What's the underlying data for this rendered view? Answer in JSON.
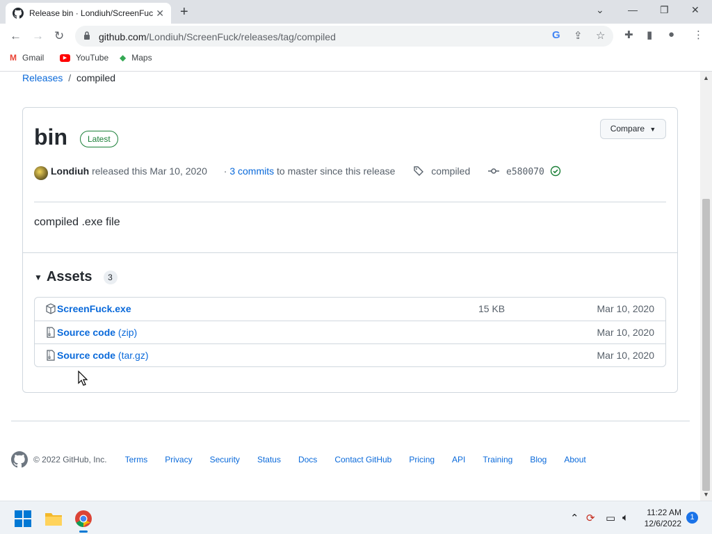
{
  "browser": {
    "tab_title": "Release bin · Londiuh/ScreenFuck",
    "url_host": "github.com",
    "url_path": "/Londiuh/ScreenFuck/releases/tag/compiled",
    "bookmarks": [
      {
        "label": "Gmail",
        "icon": "gmail-icon"
      },
      {
        "label": "YouTube",
        "icon": "youtube-icon"
      },
      {
        "label": "Maps",
        "icon": "maps-icon"
      }
    ]
  },
  "breadcrumb": {
    "parent": "Releases",
    "separator": "/",
    "current": "compiled"
  },
  "release": {
    "title": "bin",
    "badge": "Latest",
    "compare_label": "Compare",
    "author": "Londiuh",
    "released_text": "released this",
    "date": "Mar 10, 2020",
    "commits_prefix": "·",
    "commits_link": "3 commits",
    "commits_suffix": "to master since this release",
    "tag": "compiled",
    "commit_sha": "e580070",
    "description": "compiled .exe file"
  },
  "assets": {
    "heading": "Assets",
    "count": "3",
    "items": [
      {
        "name": "ScreenFuck.exe",
        "ext": "",
        "size": "15 KB",
        "date": "Mar 10, 2020",
        "icon": "package-icon"
      },
      {
        "name": "Source code",
        "ext": "(zip)",
        "size": "",
        "date": "Mar 10, 2020",
        "icon": "file-zip-icon"
      },
      {
        "name": "Source code",
        "ext": "(tar.gz)",
        "size": "",
        "date": "Mar 10, 2020",
        "icon": "file-zip-icon"
      }
    ]
  },
  "footer": {
    "copyright": "© 2022 GitHub, Inc.",
    "links": [
      "Terms",
      "Privacy",
      "Security",
      "Status",
      "Docs",
      "Contact GitHub",
      "Pricing",
      "API",
      "Training",
      "Blog",
      "About"
    ]
  },
  "taskbar": {
    "time": "11:22 AM",
    "date": "12/6/2022",
    "notifications": "1"
  },
  "colors": {
    "link": "#0969da",
    "latest_badge": "#1a7f37",
    "border": "#d0d7de"
  }
}
